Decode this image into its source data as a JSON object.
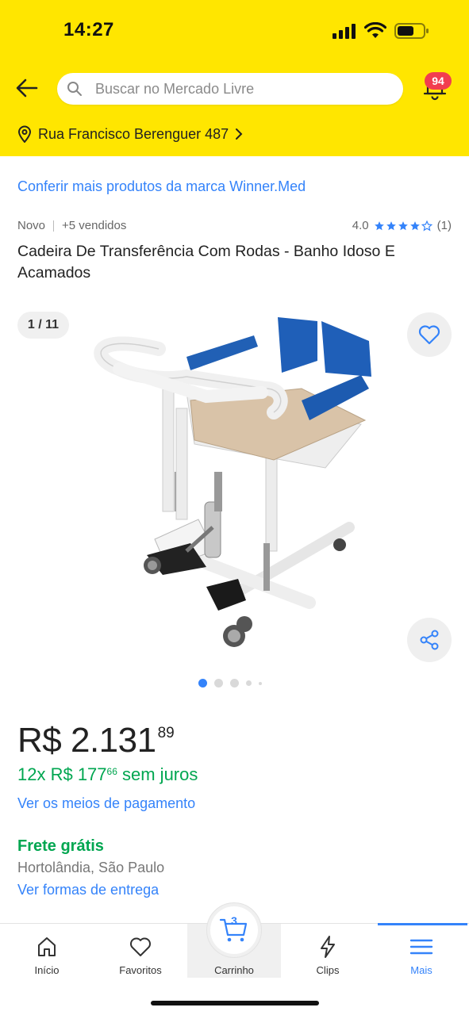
{
  "status_bar": {
    "time": "14:27"
  },
  "search": {
    "placeholder": "Buscar no Mercado Livre"
  },
  "notifications": {
    "count": "94"
  },
  "address": {
    "label": "Rua Francisco Berenguer 487"
  },
  "brand_link": "Conferir mais produtos da marca Winner.Med",
  "product": {
    "condition": "Novo",
    "sold": "+5 vendidos",
    "rating": "4.0",
    "rating_value": 4,
    "reviews": "(1)",
    "title": "Cadeira De Transferência Com Rodas - Banho Idoso E Acamados"
  },
  "gallery": {
    "counter": "1 / 11",
    "current_index": 1,
    "total": 11
  },
  "price": {
    "main": "R$ 2.131",
    "cents": "89",
    "installments_prefix": "12x R$ 177",
    "installments_cents": "66",
    "installments_suffix": " sem juros",
    "payment_link": "Ver os meios de pagamento"
  },
  "shipping": {
    "title": "Frete grátis",
    "location": "Hortolândia, São Paulo",
    "link": "Ver formas de entrega"
  },
  "cart": {
    "count": "3"
  },
  "bottom_nav": [
    {
      "label": "Início",
      "icon": "home-icon"
    },
    {
      "label": "Favoritos",
      "icon": "heart-icon"
    },
    {
      "label": "Carrinho",
      "icon": "cart-icon"
    },
    {
      "label": "Clips",
      "icon": "lightning-icon"
    },
    {
      "label": "Mais",
      "icon": "menu-icon",
      "active": true
    }
  ],
  "colors": {
    "header_bg": "#FFE600",
    "link": "#3483FA",
    "green": "#00A650",
    "badge": "#F23D4F"
  }
}
